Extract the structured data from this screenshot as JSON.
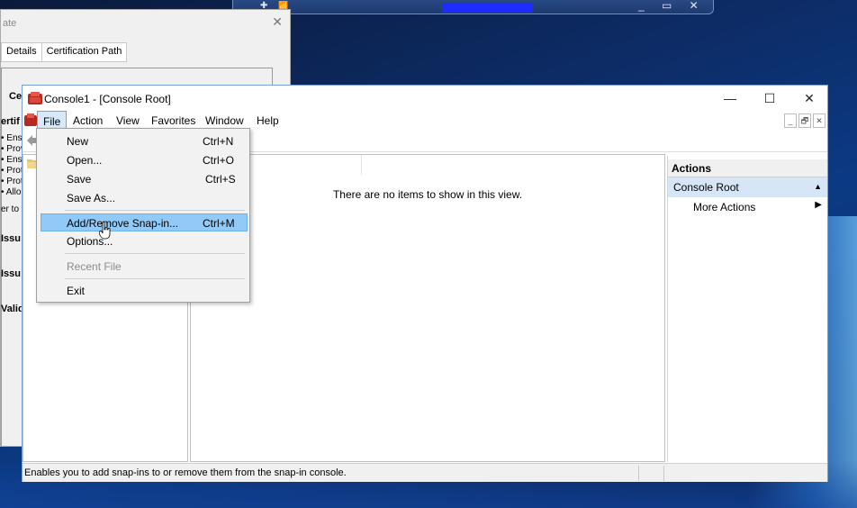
{
  "remote_bar": {
    "pin_glyph": "✚",
    "signal_glyph": "📶",
    "controls": "_ ▭ ✕"
  },
  "cert_dialog": {
    "title": "ate",
    "close": "✕",
    "tabs": [
      "Details",
      "Certification Path"
    ],
    "fragments": {
      "heading": "Ce",
      "purpose_heading": "ertif",
      "bullets": [
        "• Ens",
        "• Prov",
        "• Ens",
        "• Prot",
        "• Prot",
        "• Allo"
      ],
      "refer": "er to",
      "issued_to": "Issu",
      "issued_by": "Issu",
      "valid": "Valid"
    }
  },
  "window": {
    "title": "Console1 - [Console Root]",
    "buttons": {
      "minimize": "—",
      "maximize": "☐",
      "close": "✕"
    },
    "menu": [
      "File",
      "Action",
      "View",
      "Favorites",
      "Window",
      "Help"
    ],
    "mdi_buttons": [
      "_",
      "🗗",
      "✕"
    ],
    "empty_message": "There are no items to show in this view.",
    "status": "Enables you to add snap-ins to or remove them from the snap-in console."
  },
  "actions_pane": {
    "header": "Actions",
    "selected": "Console Root",
    "selected_arrow": "▲",
    "more": "More Actions",
    "more_arrow": "▶"
  },
  "file_menu": {
    "items": [
      {
        "label": "New",
        "shortcut": "Ctrl+N"
      },
      {
        "label": "Open...",
        "shortcut": "Ctrl+O"
      },
      {
        "label": "Save",
        "shortcut": "Ctrl+S"
      },
      {
        "label": "Save As...",
        "shortcut": ""
      },
      {
        "label": "Add/Remove Snap-in...",
        "shortcut": "Ctrl+M"
      },
      {
        "label": "Options...",
        "shortcut": ""
      },
      {
        "label": "Recent File",
        "shortcut": ""
      },
      {
        "label": "Exit",
        "shortcut": ""
      }
    ]
  },
  "colors": {
    "highlight": "#91c9f7",
    "menu_selected": "#d8e9fb",
    "actions_selected": "#d7e6f7",
    "desktop": "#0d2c66"
  }
}
